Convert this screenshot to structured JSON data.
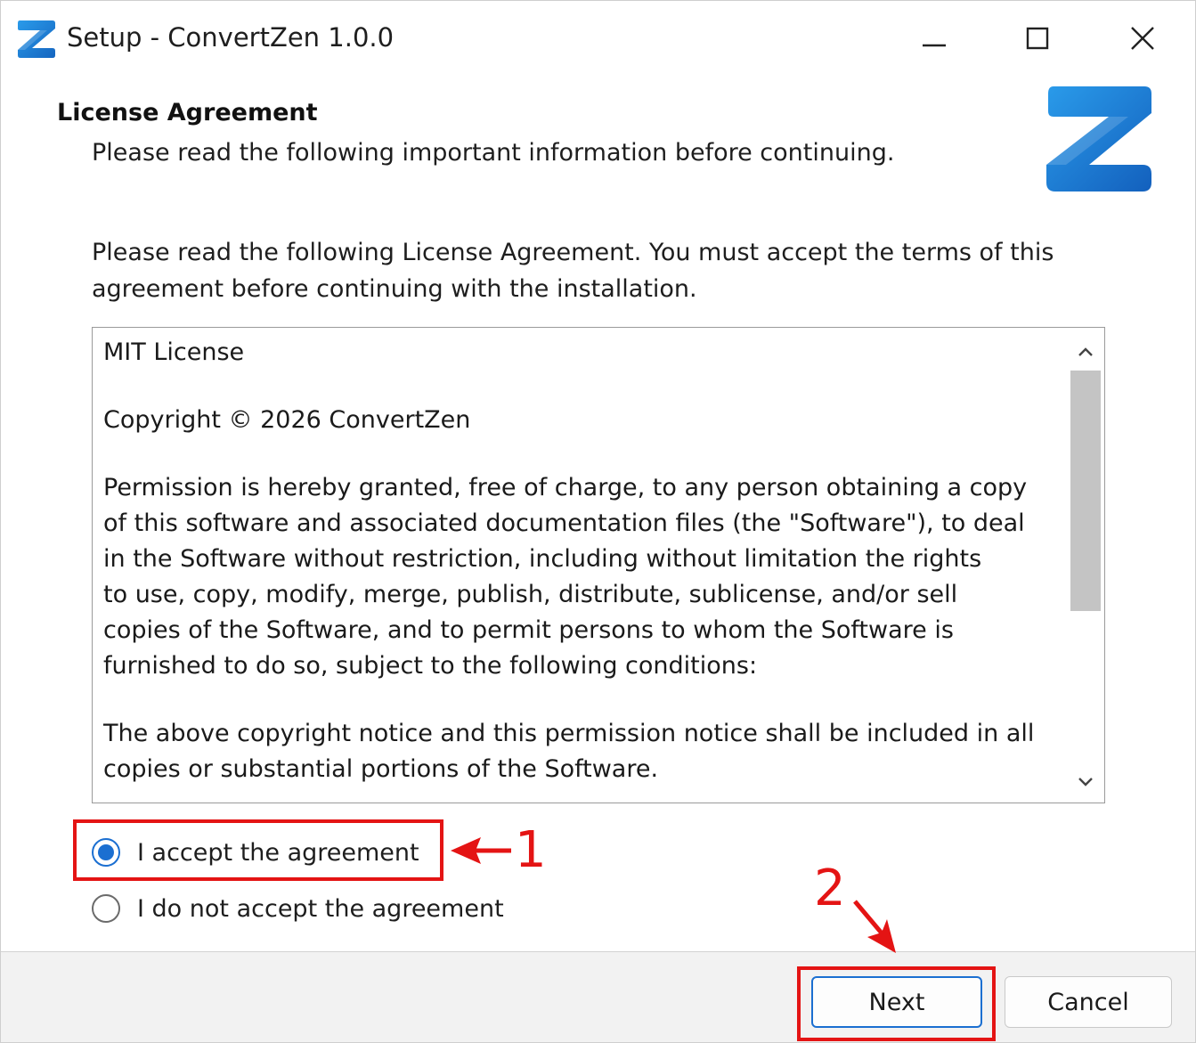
{
  "window": {
    "title": "Setup - ConvertZen 1.0.0",
    "app_icon": "convertzen-z-icon",
    "controls": {
      "minimize_icon": "minimize-icon",
      "maximize_icon": "maximize-icon",
      "close_icon": "close-icon"
    }
  },
  "header": {
    "title": "License Agreement",
    "subtitle": "Please read the following important information before continuing.",
    "logo_icon": "convertzen-z-logo"
  },
  "intro": "Please read the following License Agreement. You must accept the terms of this agreement before continuing with the installation.",
  "license": {
    "paragraphs": [
      "MIT License",
      "Copyright © 2026 ConvertZen",
      "Permission is hereby granted, free of charge, to any person obtaining a copy\nof this software and associated documentation files (the \"Software\"), to deal\nin the Software without restriction, including without limitation the rights\nto use, copy, modify, merge, publish, distribute, sublicense, and/or sell\ncopies of the Software, and to permit persons to whom the Software is\nfurnished to do so, subject to the following conditions:",
      "The above copyright notice and this permission notice shall be included in all\ncopies or substantial portions of the Software."
    ],
    "scroll_up_icon": "chevron-up-icon",
    "scroll_down_icon": "chevron-down-icon"
  },
  "options": {
    "accept_label": "I accept the agreement",
    "decline_label": "I do not accept the agreement",
    "selected": "accept"
  },
  "annotations": {
    "step1": "1",
    "step2": "2",
    "color": "#e41414"
  },
  "footer": {
    "next_label": "Next",
    "cancel_label": "Cancel"
  },
  "colors": {
    "accent": "#1b6fd1",
    "logo_blue": "#1f7fd6",
    "footer_bg": "#f2f2f2"
  }
}
